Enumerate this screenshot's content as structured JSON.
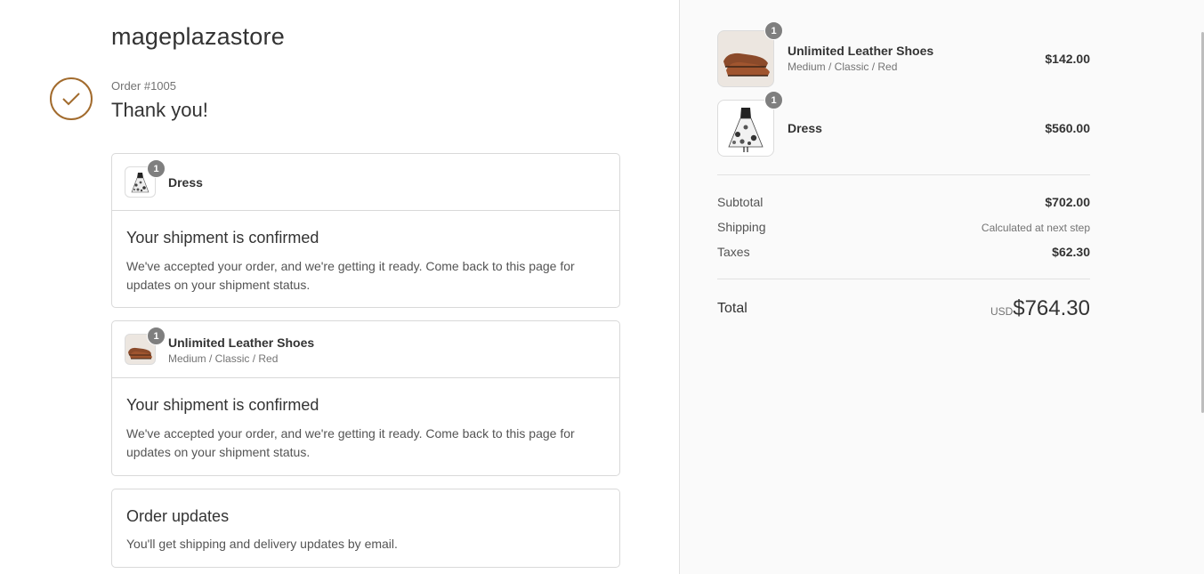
{
  "store": {
    "name": "mageplazastore"
  },
  "order": {
    "number": "Order #1005",
    "thank_you": "Thank you!"
  },
  "shipments": [
    {
      "item_name": "Dress",
      "item_variant": "",
      "quantity": "1",
      "title": "Your shipment is confirmed",
      "message": "We've accepted your order, and we're getting it ready. Come back to this page for updates on your shipment status."
    },
    {
      "item_name": "Unlimited Leather Shoes",
      "item_variant": "Medium / Classic / Red",
      "quantity": "1",
      "title": "Your shipment is confirmed",
      "message": "We've accepted your order, and we're getting it ready. Come back to this page for updates on your shipment status."
    }
  ],
  "order_updates": {
    "title": "Order updates",
    "message": "You'll get shipping and delivery updates by email."
  },
  "summary": {
    "items": [
      {
        "name": "Unlimited Leather Shoes",
        "variant": "Medium / Classic / Red",
        "quantity": "1",
        "price": "$142.00"
      },
      {
        "name": "Dress",
        "variant": "",
        "quantity": "1",
        "price": "$560.00"
      }
    ],
    "subtotal_label": "Subtotal",
    "subtotal_value": "$702.00",
    "shipping_label": "Shipping",
    "shipping_value": "Calculated at next step",
    "taxes_label": "Taxes",
    "taxes_value": "$62.30",
    "total_label": "Total",
    "total_currency": "USD",
    "total_value": "$764.30"
  },
  "colors": {
    "accent": "#a26b2d",
    "badge": "#7f7f7f",
    "sidebar_bg": "#fafafa"
  }
}
